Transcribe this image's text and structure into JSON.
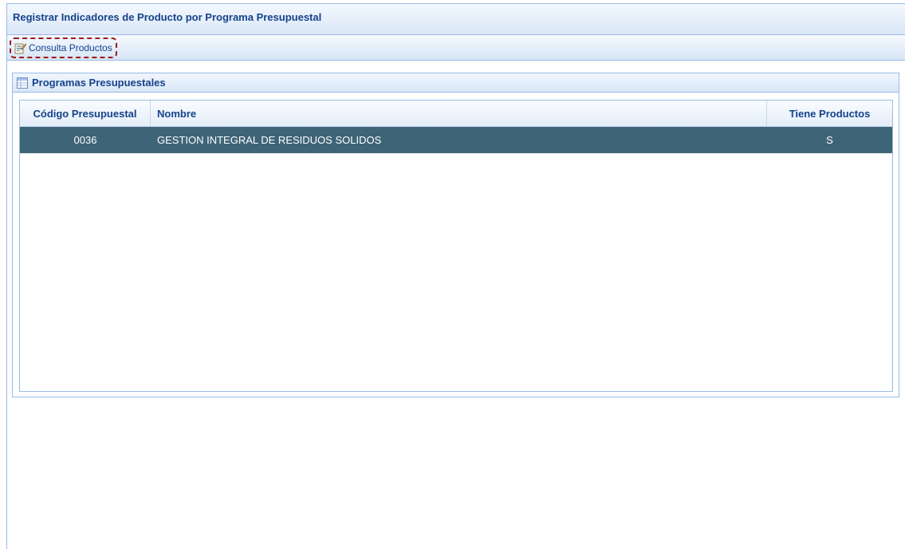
{
  "window": {
    "title": "Registrar Indicadores de Producto por Programa Presupuestal"
  },
  "toolbar": {
    "consulta_label": "Consulta Productos",
    "consulta_icon": "document-edit-icon"
  },
  "panel": {
    "title": "Programas Presupuestales",
    "icon": "table-icon"
  },
  "grid": {
    "columns": [
      "Código Presupuestal",
      "Nombre",
      "Tiene Productos"
    ],
    "rows": [
      {
        "code": "0036",
        "name": "GESTION INTEGRAL DE RESIDUOS SOLIDOS",
        "has_products": "S"
      }
    ]
  },
  "colors": {
    "header_text": "#15428b",
    "selected_row": "#3e6478",
    "border": "#99bbe8",
    "highlight_dash": "#a01818"
  }
}
